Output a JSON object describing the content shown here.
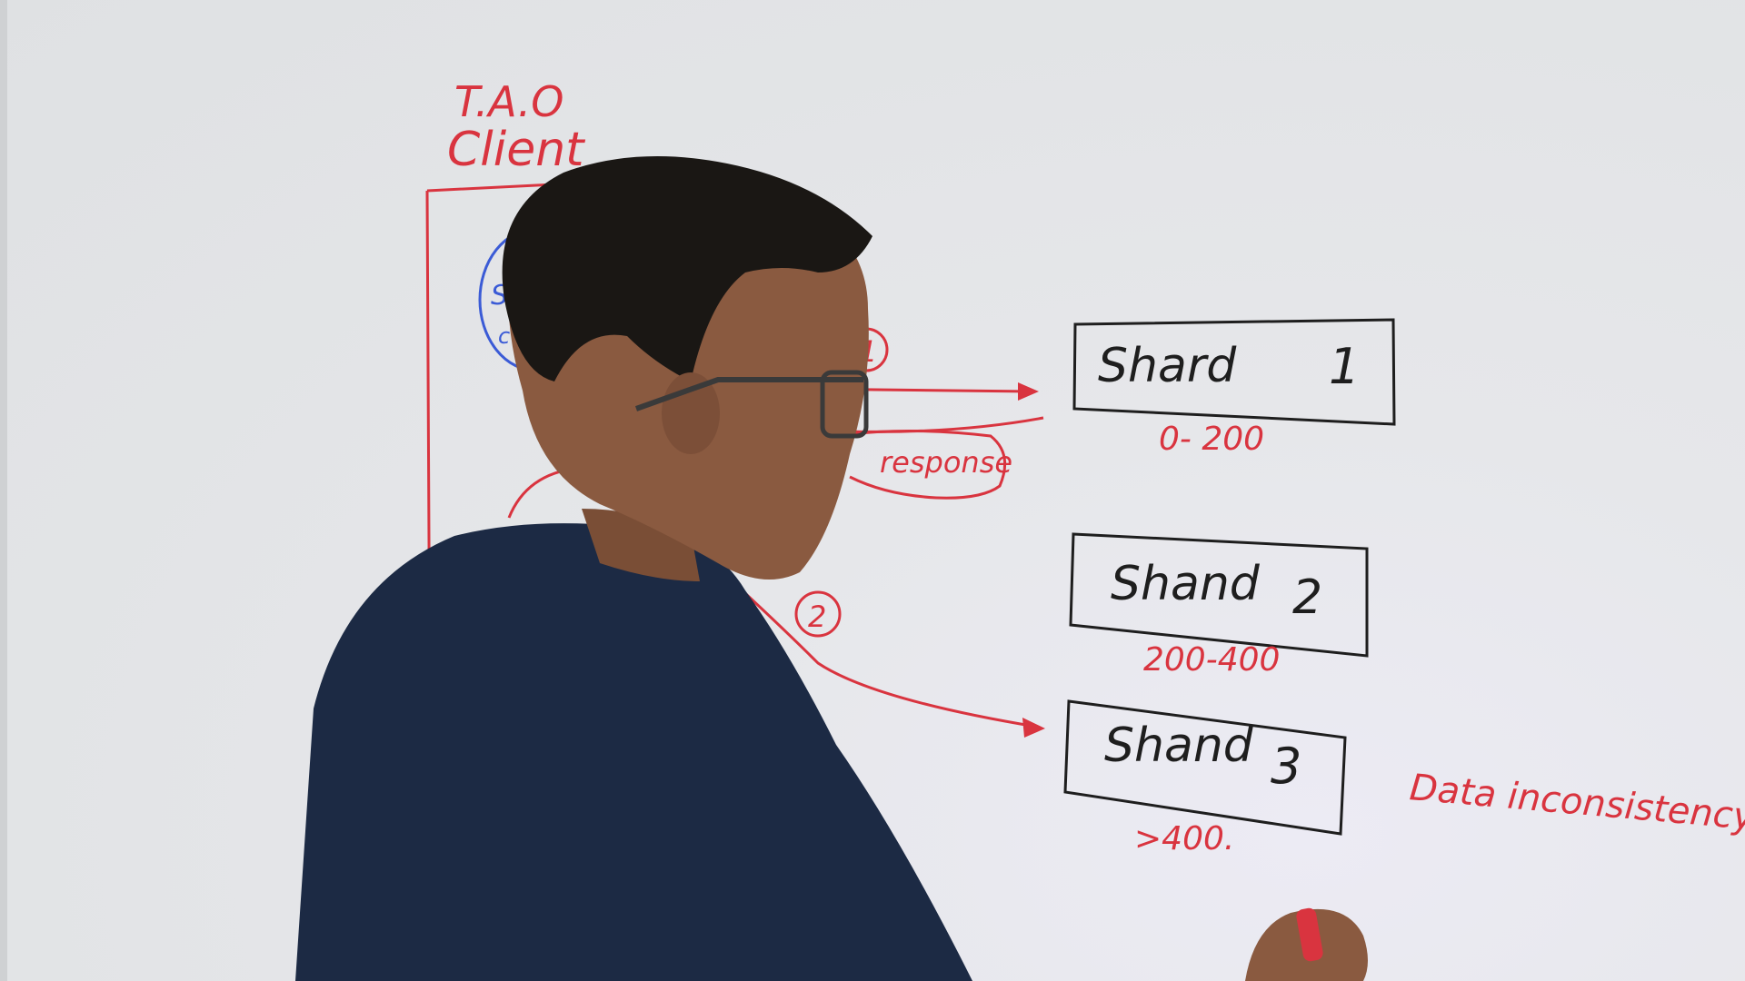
{
  "board": {
    "client_title_line1": "T.A.O",
    "client_title_line2": "Client",
    "step1": "1",
    "step2": "2",
    "response_label": "response",
    "side_note": "Data inconsistency",
    "client_partial_letter_1": "S",
    "client_partial_letter_2": "c"
  },
  "shards": [
    {
      "label": "Shard",
      "number": "1",
      "range": "0- 200"
    },
    {
      "label": "Shand",
      "number": "2",
      "range": "200-400"
    },
    {
      "label": "Shand",
      "number": "3",
      "range": ">400."
    }
  ],
  "colors": {
    "marker_red": "#d9343f",
    "marker_black": "#1e1e1e",
    "marker_blue": "#3b5bd6",
    "board": "#e3e4e6",
    "shirt": "#1c2a44",
    "skin": "#8a5a40",
    "hair": "#1a1714"
  }
}
